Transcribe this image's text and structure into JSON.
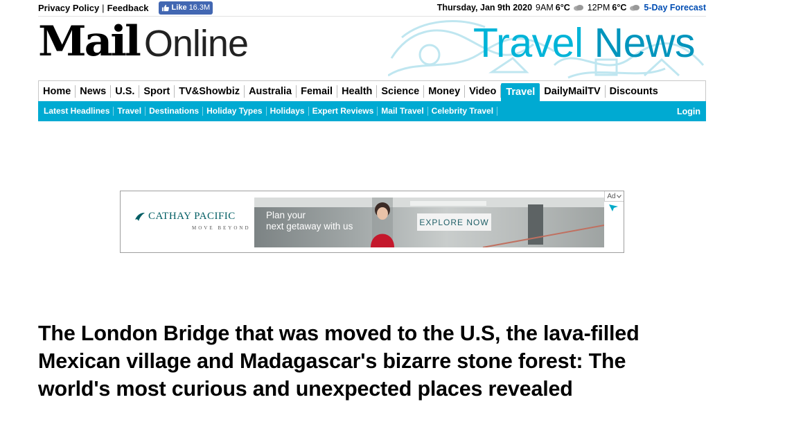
{
  "topbar": {
    "privacy": "Privacy Policy",
    "feedback": "Feedback",
    "fb_like": "Like",
    "fb_count": "16.3M",
    "date": "Thursday, Jan 9th 2020",
    "time1": "9AM",
    "temp1": "6°C",
    "time2": "12PM",
    "temp2": "6°C",
    "forecast": "5-Day Forecast"
  },
  "logo": {
    "mail": "Mail",
    "online": "Online"
  },
  "section_title": {
    "w1": "Travel",
    "w2": "News"
  },
  "mainnav": [
    "Home",
    "News",
    "U.S.",
    "Sport",
    "TV&Showbiz",
    "Australia",
    "Femail",
    "Health",
    "Science",
    "Money",
    "Video",
    "Travel",
    "DailyMailTV",
    "Discounts"
  ],
  "subnav": [
    "Latest Headlines",
    "Travel",
    "Destinations",
    "Holiday Types",
    "Holidays",
    "Expert Reviews",
    "Mail Travel",
    "Celebrity Travel"
  ],
  "login": "Login",
  "ad": {
    "brand": "CATHAY PACIFIC",
    "tagline": "MOVE BEYOND",
    "line1": "Plan your",
    "line2": "next getaway with us",
    "cta": "EXPLORE NOW",
    "label": "Ad"
  },
  "headline": "The London Bridge that was moved to the U.S, the lava-filled Mexican village and Madagascar's bizarre stone forest: The world's most curious and unexpected places revealed",
  "colors": {
    "accent": "#00aad2",
    "fb": "#4267b2",
    "link": "#004db3"
  }
}
